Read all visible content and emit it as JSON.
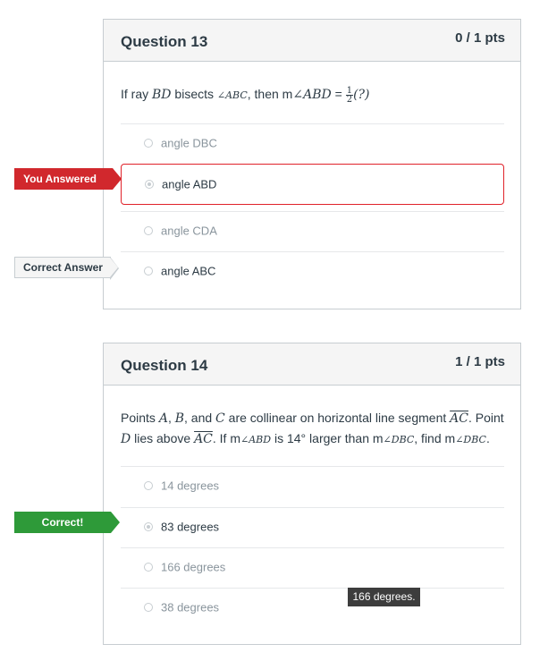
{
  "q13": {
    "title": "Question 13",
    "points": "0 / 1 pts",
    "text_prefix": "If ray ",
    "text_bd": "BD",
    "text_mid": " bisects ",
    "text_angle": "∠ABC",
    "text_then": ", then m",
    "text_angle2": "∠ABD",
    "text_eq": " = ",
    "frac_num": "1",
    "frac_den": "2",
    "text_paren": "(?)",
    "answers": [
      {
        "label": "angle DBC"
      },
      {
        "label": "angle ABD"
      },
      {
        "label": "angle CDA"
      },
      {
        "label": "angle ABC"
      }
    ],
    "flag_you_answered": "You Answered",
    "flag_correct_answer": "Correct Answer"
  },
  "q14": {
    "title": "Question 14",
    "points": "1 / 1 pts",
    "t1": "Points ",
    "t_a": "A",
    "t2": ", ",
    "t_b": "B",
    "t3": ", and ",
    "t_c": "C",
    "t4": " are collinear on horizontal line segment ",
    "t_ac": "AC",
    "t5": ". Point",
    "t_d": "D",
    "t6": " lies above ",
    "t_ac2": "AC",
    "t7": ". If m",
    "t_abd": "∠ABD",
    "t8": " is 14° larger than m",
    "t_dbc": "∠DBC",
    "t9": ", find m",
    "t_dbc2": "∠DBC",
    "t10": ".",
    "answers": [
      {
        "label": "14 degrees"
      },
      {
        "label": "83 degrees"
      },
      {
        "label": "166 degrees"
      },
      {
        "label": "38 degrees"
      }
    ],
    "flag_correct": "Correct!"
  },
  "tooltip": "166 degrees."
}
